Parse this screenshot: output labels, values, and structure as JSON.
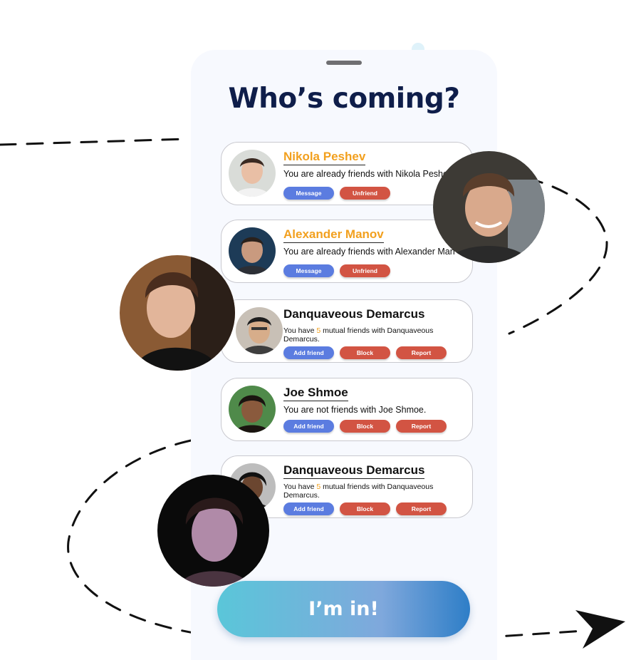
{
  "title": "Who’s coming?",
  "people": [
    {
      "name": "Nikola Peshev",
      "status": "You are already friends with Nikola Peshev",
      "buttons": {
        "message": "Message",
        "unfriend": "Unfriend"
      }
    },
    {
      "name": "Alexander Manov",
      "status": "You are already friends with Alexander Manov",
      "buttons": {
        "message": "Message",
        "unfriend": "Unfriend"
      }
    },
    {
      "name": "Danquaveous Demarcus",
      "status_prefix": "You have ",
      "mutual_count": "5",
      "status_suffix": " mutual friends with Danquaveous Demarcus.",
      "buttons": {
        "add": "Add friend",
        "block": "Block",
        "report": "Report"
      }
    },
    {
      "name": "Joe Shmoe",
      "status": "You are not friends with Joe Shmoe.",
      "buttons": {
        "add": "Add friend",
        "block": "Block",
        "report": "Report"
      }
    },
    {
      "name": "Danquaveous Demarcus",
      "status_prefix": "You have ",
      "mutual_count": "5",
      "status_suffix": " mutual friends with Danquaveous Demarcus.",
      "buttons": {
        "add": "Add friend",
        "block": "Block",
        "report": "Report"
      }
    }
  ],
  "cta_label": "I’m in!",
  "colors": {
    "title": "#0f1e4a",
    "highlight_name": "#f2a01e",
    "button_blue": "#5b7ce0",
    "button_red": "#d25443",
    "cta_gradient": [
      "#5ac6d9",
      "#7fa8dc",
      "#2e7ec7"
    ]
  },
  "icons": [
    "send-arrow-icon"
  ]
}
